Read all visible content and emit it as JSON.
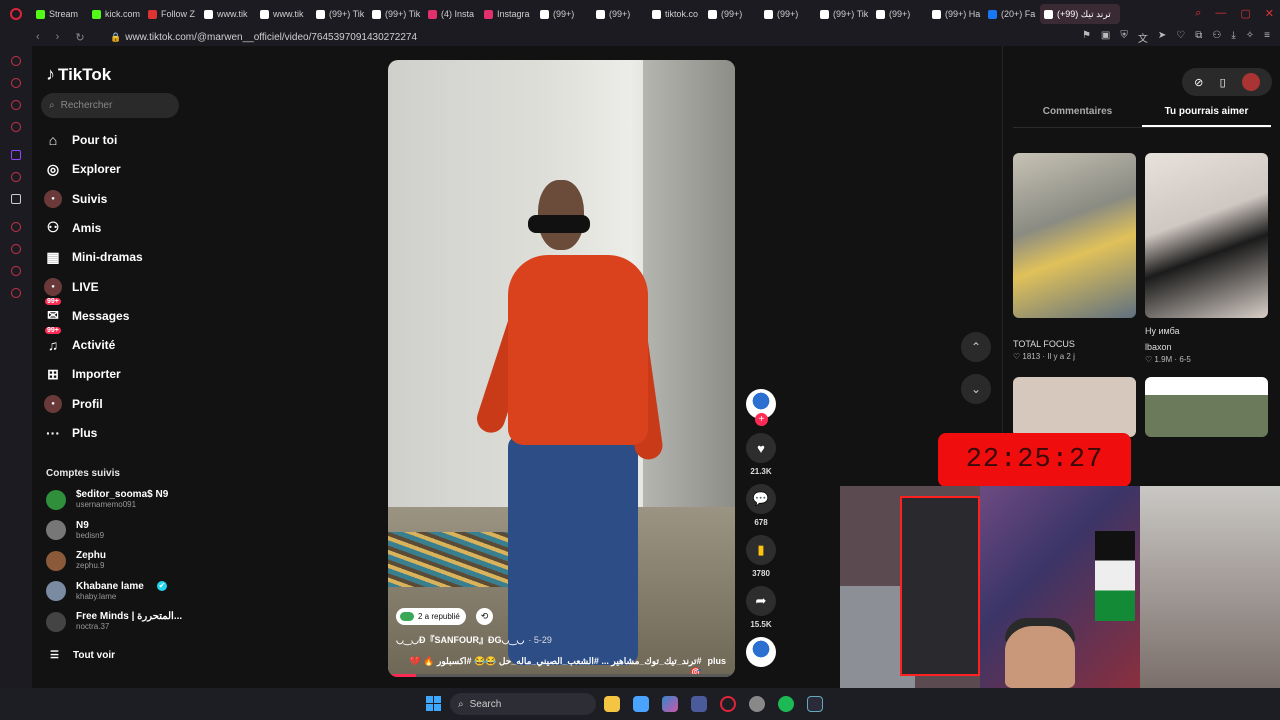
{
  "tabs": [
    {
      "label": "Stream",
      "color": "#53fc18",
      "active": false
    },
    {
      "label": "kick.com",
      "color": "#53fc18",
      "active": false
    },
    {
      "label": "Follow Z",
      "color": "#d33",
      "active": false
    },
    {
      "label": "www.tik",
      "color": "#fff",
      "active": false
    },
    {
      "label": "www.tik",
      "color": "#fff",
      "active": false
    },
    {
      "label": "(99+) Tik",
      "color": "#fff",
      "active": false
    },
    {
      "label": "(99+) Tik",
      "color": "#fff",
      "active": false
    },
    {
      "label": "(4) Insta",
      "color": "#e1306c",
      "active": false
    },
    {
      "label": "Instagra",
      "color": "#e1306c",
      "active": false
    },
    {
      "label": "(99+)",
      "color": "#fff",
      "active": false
    },
    {
      "label": "(99+)",
      "color": "#fff",
      "active": false
    },
    {
      "label": "tiktok.co",
      "color": "#fff",
      "active": false
    },
    {
      "label": "(99+)",
      "color": "#fff",
      "active": false
    },
    {
      "label": "(99+)",
      "color": "#fff",
      "active": false
    },
    {
      "label": "(99+) Tik",
      "color": "#fff",
      "active": false
    },
    {
      "label": "(99+)",
      "color": "#fff",
      "active": false
    },
    {
      "label": "(99+) Ha",
      "color": "#fff",
      "active": false
    },
    {
      "label": "(20+) Fa",
      "color": "#1877f2",
      "active": false
    },
    {
      "label": "ترند تيك (99+)",
      "color": "#fff",
      "active": true
    }
  ],
  "url": "www.tiktok.com/@marwen__officiel/video/7645397091430272274",
  "brand": {
    "name": "TikTok",
    "accent": "#fe2c55"
  },
  "search": {
    "placeholder": "Rechercher"
  },
  "nav": [
    {
      "label": "Pour toi",
      "icon": "home-icon",
      "glyph": "⌂",
      "badge": ""
    },
    {
      "label": "Explorer",
      "icon": "compass-icon",
      "glyph": "◎",
      "badge": ""
    },
    {
      "label": "Suivis",
      "icon": "following-avatar-icon",
      "glyph": "●",
      "badge": ""
    },
    {
      "label": "Amis",
      "icon": "friends-icon",
      "glyph": "⚇",
      "badge": ""
    },
    {
      "label": "Mini-dramas",
      "icon": "film-icon",
      "glyph": "▦",
      "badge": ""
    },
    {
      "label": "LIVE",
      "icon": "live-avatar-icon",
      "glyph": "●",
      "badge": ""
    },
    {
      "label": "Messages",
      "icon": "messages-icon",
      "glyph": "✉",
      "badge": "99+"
    },
    {
      "label": "Activité",
      "icon": "activity-icon",
      "glyph": "♫",
      "badge": "99+"
    },
    {
      "label": "Importer",
      "icon": "upload-icon",
      "glyph": "⊞",
      "badge": ""
    },
    {
      "label": "Profil",
      "icon": "profile-avatar-icon",
      "glyph": "●",
      "badge": ""
    },
    {
      "label": "Plus",
      "icon": "more-icon",
      "glyph": "···",
      "badge": ""
    }
  ],
  "following_title": "Comptes suivis",
  "following": [
    {
      "name": "$editor_sooma$ N9",
      "user": "usernamemo091",
      "color": "#2f8f3a"
    },
    {
      "name": "N9",
      "user": "bedisn9",
      "color": "#777"
    },
    {
      "name": "Zephu",
      "user": "zephu.9",
      "color": "#8a5a3a"
    },
    {
      "name": "Khabane lame",
      "user": "khaby.lame",
      "color": "#7a8aa0",
      "verified": true
    },
    {
      "name": "Free Minds | المتحررة...",
      "user": "noctra.37",
      "color": "#444"
    }
  ],
  "see_all": "Tout voir",
  "video": {
    "repost": "2 a republié",
    "author": "◡‿◡Ð『SANFOUR』ÐG◡‿◡",
    "date": "· 5-29",
    "desc": "#ترند_تيك_توك_مشاهير ... #الشعب_الصيني_ماله_حل 😂😂 #اكسبلور 🔥 💔 🎯",
    "more": "plus",
    "progress": 0.08
  },
  "actions": {
    "likes": "21.3K",
    "comments": "678",
    "saves": "3780",
    "shares": "15.5K"
  },
  "right": {
    "tab_comments": "Commentaires",
    "tab_recommend": "Tu pourrais aimer",
    "items": [
      {
        "title": "TOTAL FOCUS",
        "likes": "1813",
        "time": "Il y a 2 j",
        "thumb_color": "#9a9a92"
      },
      {
        "title": "Ну имба",
        "author": "lbaxon",
        "likes": "1.9M",
        "time": "6-5",
        "thumb_color": "#d9d3cf"
      }
    ]
  },
  "clock": "22:25:27",
  "taskbar": {
    "search": "Search"
  }
}
